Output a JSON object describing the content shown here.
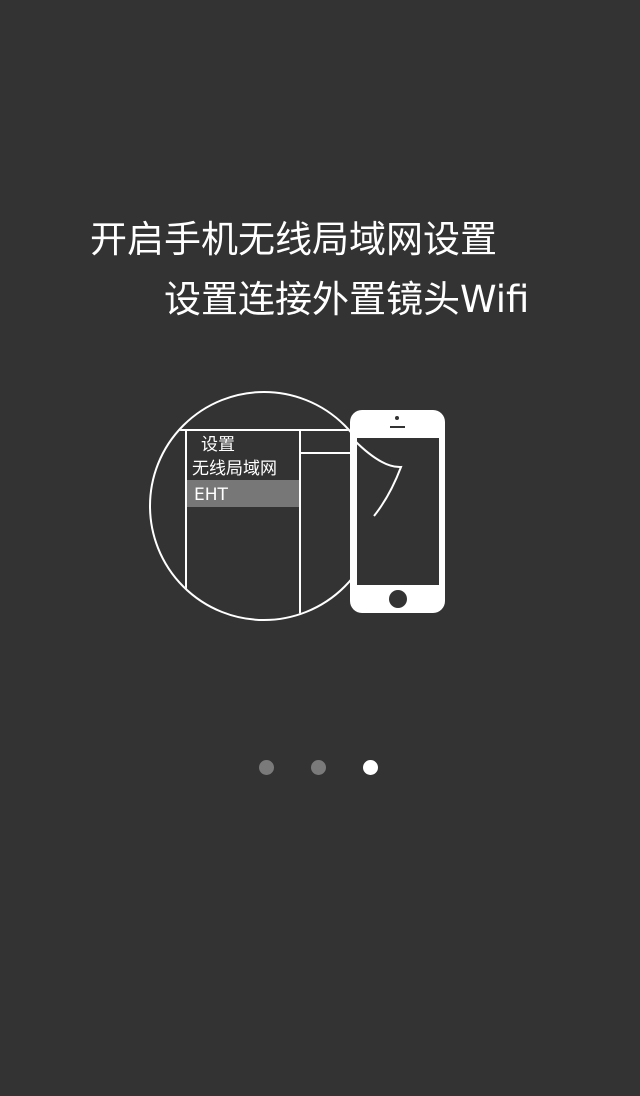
{
  "headline": {
    "line1": "开启手机无线局域网设置",
    "line2": "设置连接外置镜头Wifi"
  },
  "illustration": {
    "settings_title": "设置",
    "menu_item": "无线局域网",
    "selected_network": "EHT"
  },
  "pager": {
    "total": 3,
    "active_index": 3
  },
  "colors": {
    "background": "#333333",
    "foreground": "#ffffff",
    "inactive_dot": "#7a7a7a",
    "highlight_row": "#777777"
  }
}
